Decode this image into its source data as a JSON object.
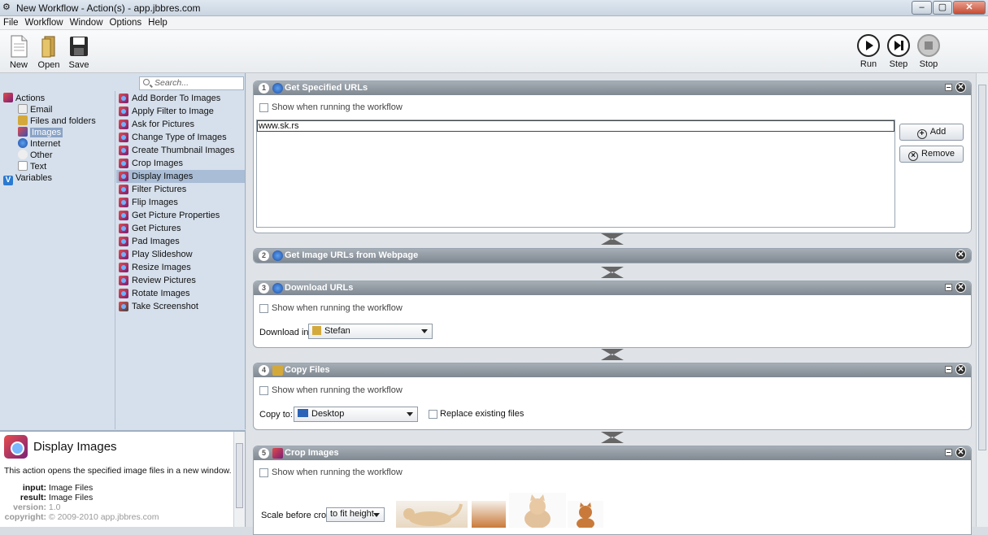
{
  "window": {
    "title": "New Workflow - Action(s) - app.jbbres.com"
  },
  "menu": [
    "File",
    "Workflow",
    "Window",
    "Options",
    "Help"
  ],
  "toolbar": {
    "new": "New",
    "open": "Open",
    "save": "Save",
    "run": "Run",
    "step": "Step",
    "stop": "Stop"
  },
  "search": {
    "placeholder": "Search..."
  },
  "categories": [
    "Actions",
    "Email",
    "Files and folders",
    "Images",
    "Internet",
    "Other",
    "Text",
    "Variables"
  ],
  "actions": [
    "Add Border To Images",
    "Apply Filter to Image",
    "Ask for Pictures",
    "Change Type of Images",
    "Create Thumbnail Images",
    "Crop Images",
    "Display Images",
    "Filter Pictures",
    "Flip Images",
    "Get Picture Properties",
    "Get Pictures",
    "Pad Images",
    "Play Slideshow",
    "Resize Images",
    "Review Pictures",
    "Rotate Images",
    "Take Screenshot"
  ],
  "selected_action": "Display Images",
  "description": {
    "title": "Display Images",
    "text": "This action opens the specified image files in a new window.",
    "input_label": "input:",
    "input_value": "Image Files",
    "result_label": "result:",
    "result_value": "Image Files",
    "version_label": "version:",
    "version_value": "1.0",
    "copyright_label": "copyright:",
    "copyright_value": "© 2009-2010 app.jbbres.com"
  },
  "steps": {
    "s1": {
      "num": "1",
      "title": "Get Specified URLs",
      "show": "Show when running the workflow",
      "url": "www.sk.rs",
      "add": "Add",
      "remove": "Remove"
    },
    "s2": {
      "num": "2",
      "title": "Get Image URLs from Webpage"
    },
    "s3": {
      "num": "3",
      "title": "Download URLs",
      "show": "Show when running the workflow",
      "download_label": "Download in:",
      "download_value": "Stefan"
    },
    "s4": {
      "num": "4",
      "title": "Copy Files",
      "show": "Show when running the workflow",
      "copy_label": "Copy to:",
      "copy_value": "Desktop",
      "replace": "Replace existing files"
    },
    "s5": {
      "num": "5",
      "title": "Crop Images",
      "show": "Show when running the workflow",
      "scale_label": "Scale before crop:",
      "scale_value": "to fit height"
    }
  },
  "colors": {
    "selection": "#a9bdd6",
    "header": "#8a939c",
    "pane": "#d6e0ec"
  }
}
